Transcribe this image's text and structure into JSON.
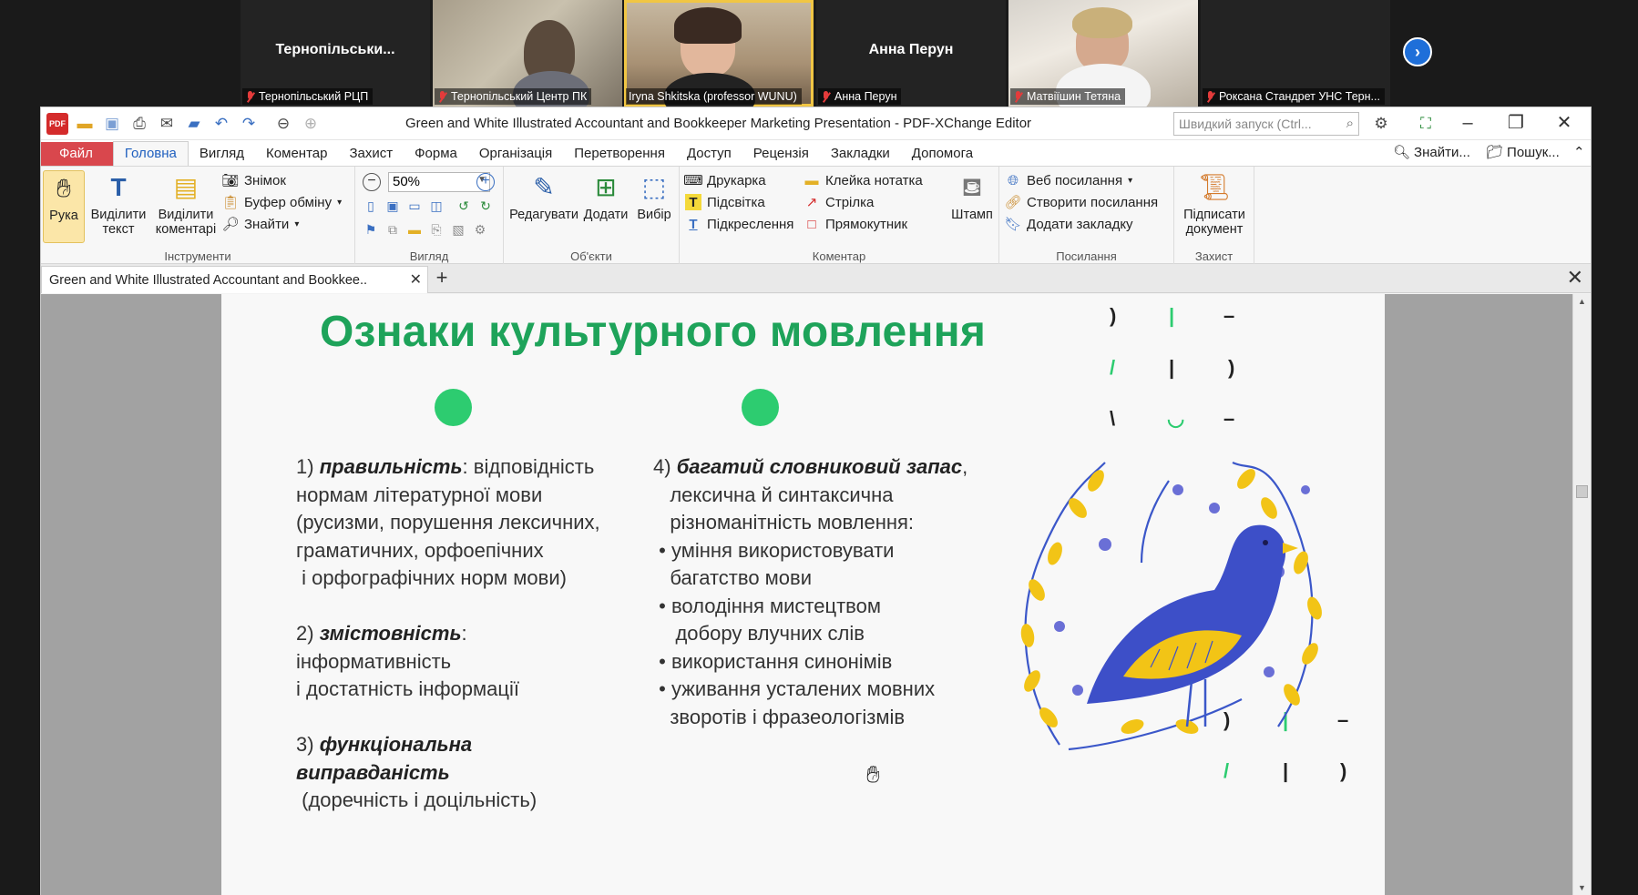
{
  "zoom_meeting": {
    "participants": [
      {
        "center_name": "Тернопільськи...",
        "caption": "Тернопільський РЦП",
        "muted": true,
        "video": false
      },
      {
        "center_name": "",
        "caption": "Тернопільський Центр ПК",
        "muted": true,
        "video": true
      },
      {
        "center_name": "",
        "caption": "Iryna Shkitska (professor WUNU)",
        "muted": false,
        "video": true,
        "active_speaker": true
      },
      {
        "center_name": "Анна Перун",
        "caption": "Анна Перун",
        "muted": true,
        "video": false
      },
      {
        "center_name": "",
        "caption": "Матвіїшин Тетяна",
        "muted": true,
        "video": true
      },
      {
        "center_name": "",
        "caption": "Роксана Стандрет УНС Терн...",
        "muted": true,
        "video": false
      }
    ],
    "next_page_icon": "chevron-right-icon"
  },
  "app": {
    "window_title": "Green and White Illustrated Accountant and Bookkeeper Marketing Presentation - PDF-XChange Editor",
    "quick_launch_placeholder": "Швидкий запуск (Ctrl...",
    "menu_tabs": [
      "Файл",
      "Головна",
      "Вигляд",
      "Коментар",
      "Захист",
      "Форма",
      "Організація",
      "Перетворення",
      "Доступ",
      "Рецензія",
      "Закладки",
      "Допомога"
    ],
    "active_tab": "Головна",
    "find_label": "Знайти...",
    "search_label": "Пошук...",
    "ribbon": {
      "tools": {
        "group_label": "Інструменти",
        "hand": "Рука",
        "select_text_1": "Виділити",
        "select_text_2": "текст",
        "select_comments_1": "Виділити",
        "select_comments_2": "коментарі",
        "snapshot": "Знімок",
        "clipboard": "Буфер обміну",
        "find": "Знайти"
      },
      "view": {
        "group_label": "Вигляд",
        "zoom": "50%"
      },
      "objects": {
        "group_label": "Об'єкти",
        "edit": "Редагувати",
        "add": "Додати",
        "select": "Вибір"
      },
      "comment": {
        "group_label": "Коментар",
        "typewriter": "Друкарка",
        "highlight": "Підсвітка",
        "underline": "Підкреслення",
        "sticky_note": "Клейка нотатка",
        "arrow": "Стрілка",
        "rectangle": "Прямокутник",
        "stamp": "Штамп"
      },
      "links": {
        "group_label": "Посилання",
        "web_links": "Веб посилання",
        "create_link": "Створити посилання",
        "add_bookmark": "Додати закладку"
      },
      "protect": {
        "group_label": "Захист",
        "sign_1": "Підписати",
        "sign_2": "документ"
      }
    },
    "document_tab": "Green and White Illustrated Accountant and Bookkee..",
    "accent_color": "#d9474d"
  },
  "slide": {
    "title": "Ознаки культурного мовлення",
    "title_color": "#1ea35a",
    "dot_color": "#2dcc70",
    "left": {
      "p1_num": "1) ",
      "p1_term": "правильність",
      "p1_rest": ": відповідність",
      "p1_lines": [
        "нормам літературної мови",
        "(русизми, порушення лексичних,",
        "граматичних, орфоепічних",
        " і орфографічних норм мови)"
      ],
      "p2_num": "2) ",
      "p2_term": "змістовність",
      "p2_rest": ":",
      "p2_lines": [
        "інформативність",
        "і достатність інформації"
      ],
      "p3_num": "3) ",
      "p3_term_1": "функціональна",
      "p3_term_2": "виправданість",
      "p3_line": " (доречність і доцільність)"
    },
    "right": {
      "p4_num": "4) ",
      "p4_term": "багатий словниковий запас",
      "p4_rest": ",",
      "p4_lines": [
        "лексична й синтаксична",
        "різноманітність мовлення:"
      ],
      "bullets": [
        "уміння використовувати",
        "багатство мови",
        "володіння мистецтвом",
        " добору влучних слів",
        "використання синонімів",
        "уживання усталених мовних",
        "зворотів і фразеологізмів"
      ]
    }
  }
}
